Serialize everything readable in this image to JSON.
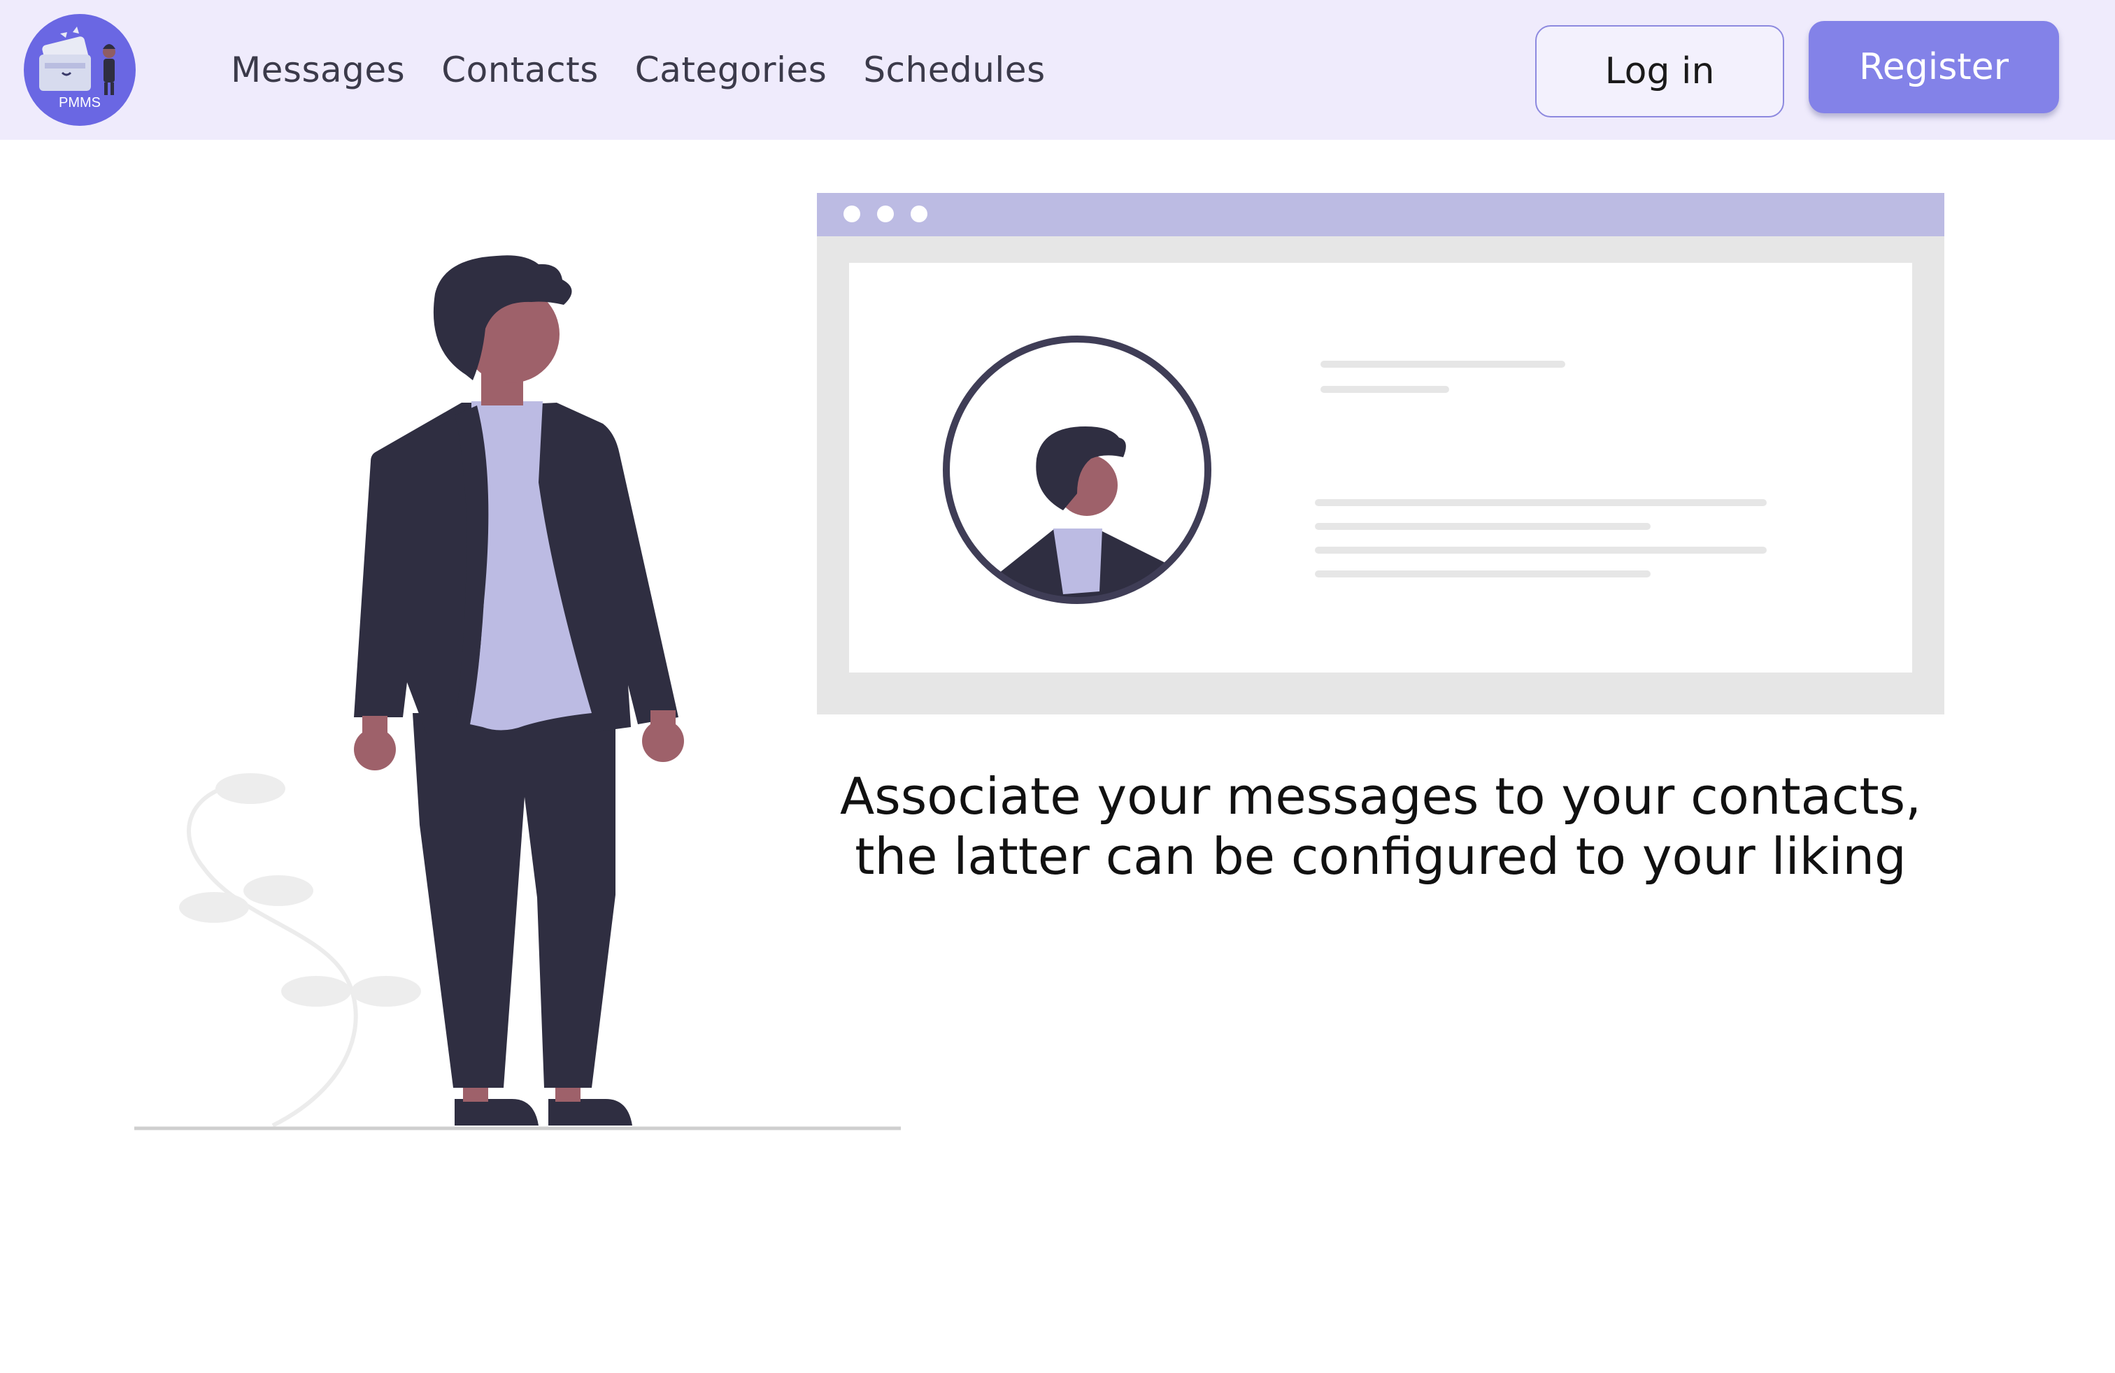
{
  "app": {
    "logo_text": "PMMS",
    "colors": {
      "header_bg": "#efebfc",
      "brand": "#6a67e3",
      "register_bg": "#8382e8",
      "accent_light": "#bcbbe3",
      "figure_dark": "#2f2e41"
    }
  },
  "nav": {
    "items": [
      {
        "label": "Messages"
      },
      {
        "label": "Contacts"
      },
      {
        "label": "Categories"
      },
      {
        "label": "Schedules"
      }
    ]
  },
  "auth": {
    "login_label": "Log in",
    "register_label": "Register"
  },
  "hero": {
    "caption_line1": "Associate your messages to your contacts,",
    "caption_line2": "the latter can be configured to your liking",
    "illustrations": [
      "standing-person",
      "profile-browser-window"
    ]
  }
}
